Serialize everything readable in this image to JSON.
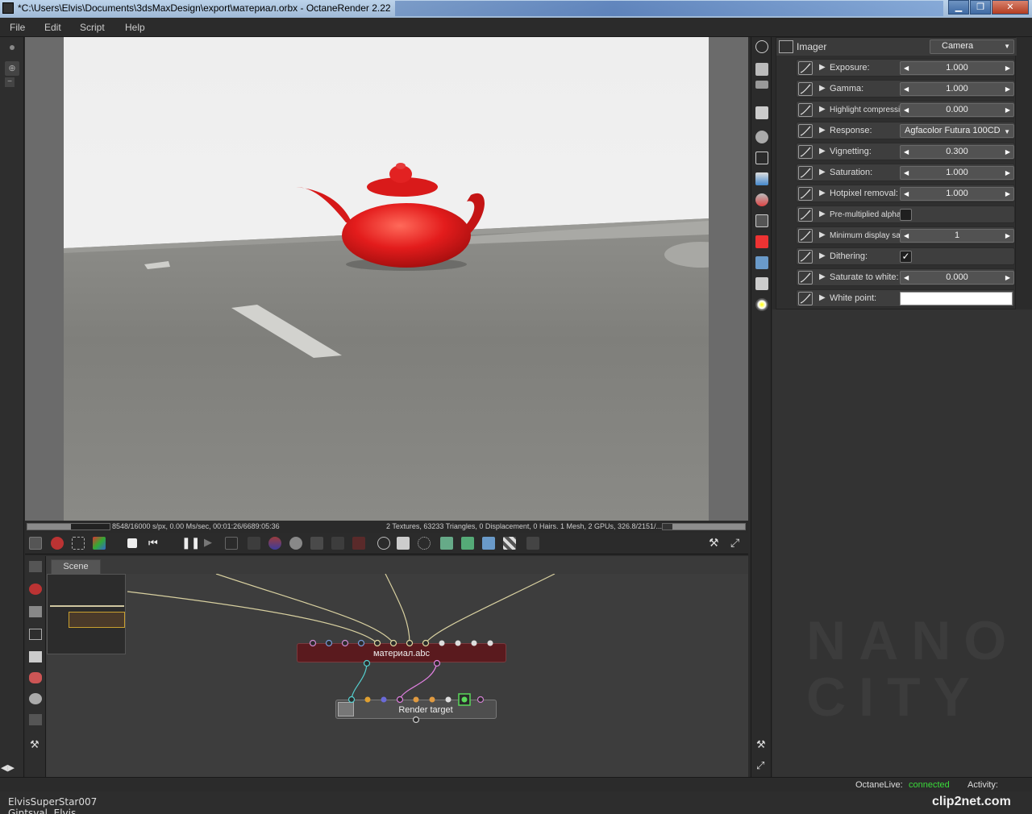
{
  "window": {
    "title": "*C:\\Users\\Elvis\\Documents\\3dsMaxDesign\\export\\материал.orbx - OctaneRender 2.22",
    "minimize": "▁",
    "maximize": "❐",
    "close": "✕"
  },
  "menu": [
    "File",
    "Edit",
    "Script",
    "Help"
  ],
  "status": {
    "left": "8548/16000 s/px, 0.00 Ms/sec, 00:01:26/6689:05:36",
    "right": "2 Textures, 63233 Triangles, 0 Displacement, 0 Hairs. 1 Mesh, 2 GPUs, 326.8/2151/...",
    "progress_fraction": 0.53,
    "memory_fraction": 0.12
  },
  "scene": {
    "tab": "Scene",
    "nodes": {
      "material": "материал.abc",
      "render_target": "Render target"
    }
  },
  "imager": {
    "title": "Imager",
    "camera": "Camera",
    "rows": [
      {
        "label": "Exposure:",
        "value": "1.000",
        "kind": "slider"
      },
      {
        "label": "Gamma:",
        "value": "1.000",
        "kind": "slider"
      },
      {
        "label": "Highlight compression:",
        "value": "0.000",
        "kind": "slider",
        "small": true
      },
      {
        "label": "Response:",
        "value": "Agfacolor Futura 100CD",
        "kind": "dropdown"
      },
      {
        "label": "Vignetting:",
        "value": "0.300",
        "kind": "slider"
      },
      {
        "label": "Saturation:",
        "value": "1.000",
        "kind": "slider"
      },
      {
        "label": "Hotpixel removal:",
        "value": "1.000",
        "kind": "slider"
      },
      {
        "label": "Pre-multiplied alpha:",
        "value": "",
        "kind": "checkbox",
        "small": true
      },
      {
        "label": "Minimum display sam...",
        "value": "1",
        "kind": "slider",
        "small": true
      },
      {
        "label": "Dithering:",
        "value": "✓",
        "kind": "checkbox"
      },
      {
        "label": "Saturate to white:",
        "value": "0.000",
        "kind": "slider"
      },
      {
        "label": "White point:",
        "value": "",
        "kind": "swatch"
      }
    ]
  },
  "bottom": {
    "octanelive_label": "OctaneLive:",
    "octanelive_status": "connected",
    "activity_label": "Activity:"
  },
  "footer": {
    "user1": "ElvisSuperStar007",
    "user2": "Gintsval, Elvis",
    "brand": "clip2net.com"
  },
  "colors": {
    "teapot": "#e31c1c",
    "connected": "#3adb3a",
    "node_material": "#5a1a1e"
  }
}
